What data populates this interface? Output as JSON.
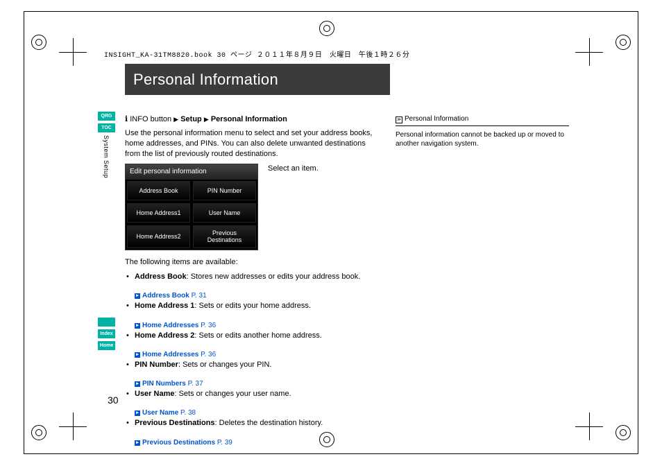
{
  "header_meta": "INSIGHT_KA-31TM8820.book  30 ページ  ２０１１年８月９日　火曜日　午後１時２６分",
  "title": "Personal Information",
  "side_tabs_top": {
    "qrg": "QRG",
    "toc": "TOC",
    "label": "System Setup"
  },
  "side_tabs_bottom": {
    "voice": "",
    "index": "Index",
    "home": "Home"
  },
  "breadcrumb": {
    "prefix": "INFO button",
    "setup": "Setup",
    "section": "Personal Information"
  },
  "intro": "Use the personal information menu to select and set your address books, home addresses, and PINs. You can also delete unwanted destinations from the list of previously routed destinations.",
  "select_item": "Select an item.",
  "edit_panel": {
    "title": "Edit personal information",
    "cells": [
      "Address Book",
      "PIN Number",
      "Home Address1",
      "User Name",
      "Home Address2",
      "Previous\nDestinations"
    ]
  },
  "available_label": "The following items are available:",
  "items": [
    {
      "name": "Address Book",
      "desc": ": Stores new addresses or edits your address book.",
      "ref": "Address Book",
      "page": "P. 31"
    },
    {
      "name": "Home Address 1",
      "desc": ": Sets or edits your home address.",
      "ref": "Home Addresses",
      "page": "P. 36"
    },
    {
      "name": "Home Address 2",
      "desc": ": Sets or edits another home address.",
      "ref": "Home Addresses",
      "page": "P. 36"
    },
    {
      "name": "PIN Number",
      "desc": ": Sets or changes your PIN.",
      "ref": "PIN Numbers",
      "page": "P. 37"
    },
    {
      "name": "User Name",
      "desc": ": Sets or changes your user name.",
      "ref": "User Name",
      "page": "P. 38"
    },
    {
      "name": "Previous Destinations",
      "desc": ": Deletes the destination history.",
      "ref": "Previous Destinations",
      "page": "P. 39"
    }
  ],
  "right": {
    "heading": "Personal Information",
    "body": "Personal information cannot be backed up or moved to another navigation system."
  },
  "page_number": "30"
}
